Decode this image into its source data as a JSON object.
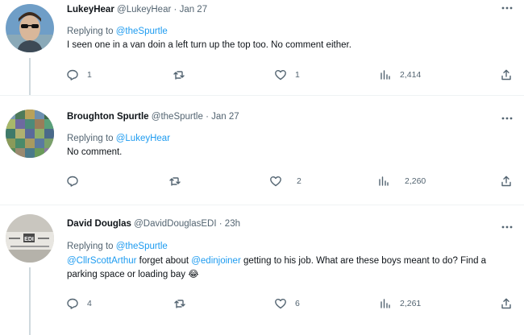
{
  "tweets": [
    {
      "name": "LukeyHear",
      "handle": "@LukeyHear",
      "sep": "·",
      "time": "Jan 27",
      "replying_prefix": "Replying to ",
      "replying_to": "@theSpurtle",
      "text": "I seen one in a van doin a left turn up the top too. No comment either.",
      "replies": "1",
      "retweets": "",
      "likes": "1",
      "views": "2,414"
    },
    {
      "name": "Broughton Spurtle",
      "handle": "@theSpurtle",
      "sep": "·",
      "time": "Jan 27",
      "replying_prefix": "Replying to ",
      "replying_to": "@LukeyHear",
      "text": "No comment.",
      "replies": "",
      "retweets": "",
      "likes": "2",
      "views": "2,260"
    },
    {
      "name": "David Douglas",
      "handle": "@DavidDouglasEDI",
      "sep": "·",
      "time": "23h",
      "replying_prefix": "Replying to ",
      "replying_to": "@theSpurtle",
      "mention_1": "@CllrScottArthur",
      "text_1": " forget about ",
      "mention_2": "@edinjoiner",
      "text_2": " getting to his job. What are these boys meant to do? Find a parking space or loading bay 😂",
      "replies": "4",
      "retweets": "",
      "likes": "6",
      "views": "2,261",
      "avatar_sign_text": "EDI"
    }
  ],
  "icons": {
    "reply": "reply-icon",
    "retweet": "retweet-icon",
    "like": "heart-icon",
    "views": "views-icon",
    "share": "share-icon",
    "more": "more-icon"
  },
  "colors": {
    "link": "#1d9bf0",
    "secondary_text": "#536471",
    "thread_line": "#cfd9de"
  }
}
